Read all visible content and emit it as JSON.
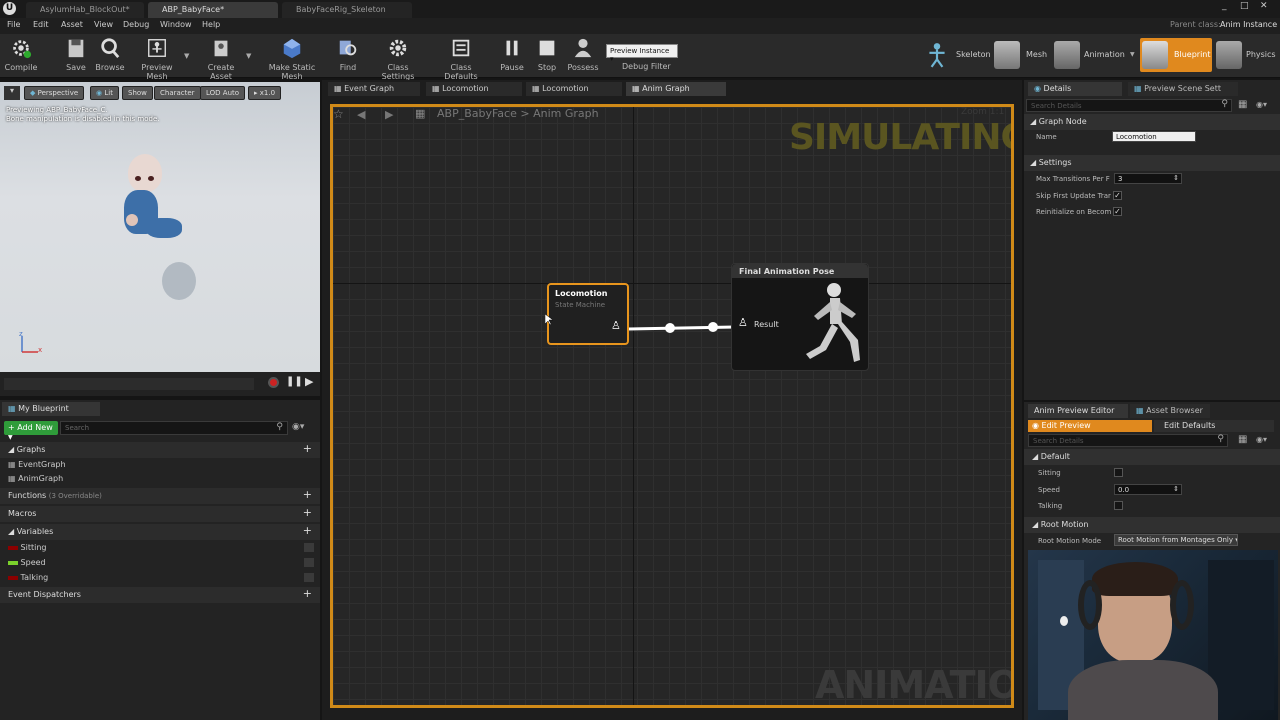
{
  "tabs": [
    {
      "label": "AsylumHab_BlockOut*"
    },
    {
      "label": "ABP_BabyFace*"
    },
    {
      "label": "BabyFaceRig_Skeleton"
    }
  ],
  "parent_class": {
    "label": "Parent class:",
    "value": "Anim Instance"
  },
  "menu": [
    "File",
    "Edit",
    "Asset",
    "View",
    "Debug",
    "Window",
    "Help"
  ],
  "toolbar": {
    "compile": "Compile",
    "save": "Save",
    "browse": "Browse",
    "preview_mesh": "Preview Mesh",
    "create_asset": "Create Asset",
    "make_static_mesh": "Make Static Mesh",
    "find": "Find",
    "class_settings": "Class Settings",
    "class_defaults": "Class Defaults",
    "pause": "Pause",
    "stop": "Stop",
    "possess": "Possess",
    "preview_instance": "Preview Instance",
    "debug_filter": "Debug Filter"
  },
  "modes": [
    "Skeleton",
    "Mesh",
    "Animation",
    "Blueprint",
    "Physics"
  ],
  "viewport": {
    "perspective": "Perspective",
    "lit": "Lit",
    "show": "Show",
    "character": "Character",
    "lod": "LOD Auto",
    "speed": "x1.0",
    "info_line1": "Previewing ABP_BabyFace_C.",
    "info_line2": "Bone manipulation is disabled in this mode."
  },
  "my_blueprint": {
    "tab": "My Blueprint",
    "add_new": "Add New",
    "search_placeholder": "Search",
    "graphs_header": "Graphs",
    "graphs": [
      "EventGraph",
      "AnimGraph"
    ],
    "functions_header": "Functions",
    "functions_count": "(3 Overridable)",
    "macros_header": "Macros",
    "variables_header": "Variables",
    "variables": [
      {
        "name": "Sitting",
        "color": "#8b0000"
      },
      {
        "name": "Speed",
        "color": "#7bd12c"
      },
      {
        "name": "Talking",
        "color": "#8b0000"
      }
    ],
    "dispatchers_header": "Event Dispatchers"
  },
  "graph_tabs": [
    "Event Graph",
    "Locomotion",
    "Locomotion",
    "Anim Graph"
  ],
  "breadcrumb": {
    "root": "ABP_BabyFace",
    "sep": ">",
    "current": "Anim Graph"
  },
  "zoom": "Zoom 1:1",
  "watermark_top": "SIMULATING",
  "watermark_bottom": "ANIMATION",
  "node_locomotion": {
    "title": "Locomotion",
    "subtitle": "State Machine"
  },
  "node_final": {
    "title": "Final Animation Pose",
    "pin": "Result"
  },
  "details": {
    "tab": "Details",
    "tab2": "Preview Scene Sett",
    "search_placeholder": "Search Details",
    "graph_node_header": "Graph Node",
    "name_label": "Name",
    "name_value": "Locomotion",
    "settings_header": "Settings",
    "max_transitions_label": "Max Transitions Per F",
    "max_transitions_value": "3",
    "skip_first_label": "Skip First Update Trar",
    "reinit_label": "Reinitialize on Becom"
  },
  "anim_preview": {
    "tab": "Anim Preview Editor",
    "tab2": "Asset Browser",
    "edit_preview": "Edit Preview",
    "edit_defaults": "Edit Defaults",
    "search_placeholder": "Search Details",
    "default_header": "Default",
    "sitting": "Sitting",
    "speed": "Speed",
    "speed_value": "0.0",
    "talking": "Talking",
    "root_motion_header": "Root Motion",
    "root_motion_mode_label": "Root Motion Mode",
    "root_motion_mode_value": "Root Motion from Montages Only"
  }
}
